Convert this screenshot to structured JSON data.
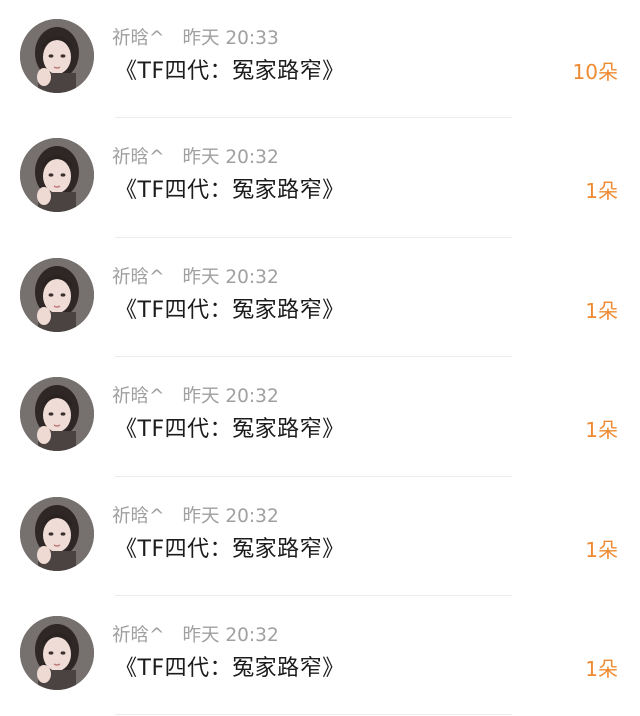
{
  "gift_list": {
    "items": [
      {
        "username": "祈晗^",
        "time": "昨天 20:33",
        "title": "《TF四代：冤家路窄》",
        "gift_count": "10朵"
      },
      {
        "username": "祈晗^",
        "time": "昨天 20:32",
        "title": "《TF四代：冤家路窄》",
        "gift_count": "1朵"
      },
      {
        "username": "祈晗^",
        "time": "昨天 20:32",
        "title": "《TF四代：冤家路窄》",
        "gift_count": "1朵"
      },
      {
        "username": "祈晗^",
        "time": "昨天 20:32",
        "title": "《TF四代：冤家路窄》",
        "gift_count": "1朵"
      },
      {
        "username": "祈晗^",
        "time": "昨天 20:32",
        "title": "《TF四代：冤家路窄》",
        "gift_count": "1朵"
      },
      {
        "username": "祈晗^",
        "time": "昨天 20:32",
        "title": "《TF四代：冤家路窄》",
        "gift_count": "1朵"
      }
    ]
  },
  "colors": {
    "username_time": "#a0a0a0",
    "title": "#1c1c1c",
    "gift_count": "#f08a32",
    "divider": "#ececec"
  },
  "icons": {
    "avatar": "user-avatar-photo"
  }
}
